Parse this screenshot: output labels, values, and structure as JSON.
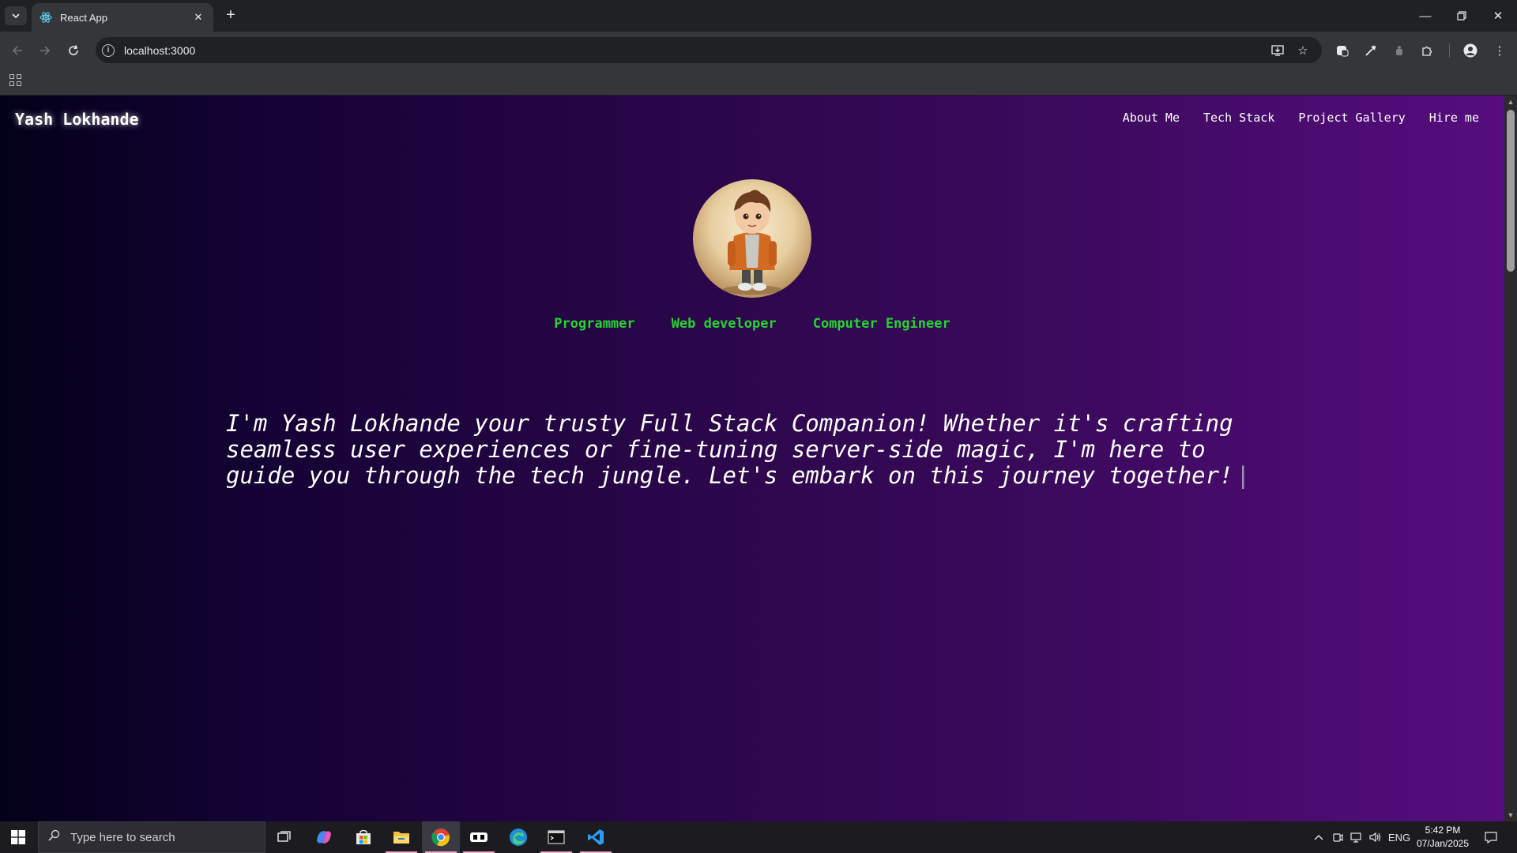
{
  "browser": {
    "tab_title": "React App",
    "url": "localhost:3000"
  },
  "site": {
    "brand": "Yash Lokhande",
    "nav": [
      "About Me",
      "Tech Stack",
      "Project Gallery",
      "Hire me"
    ],
    "roles": [
      "Programmer",
      "Web developer",
      "Computer Engineer"
    ],
    "intro": "I'm Yash Lokhande your trusty Full Stack Companion! Whether it's crafting seamless user experiences or fine-tuning server-side magic, I'm here to guide you through the tech jungle. Let's embark on this journey together!",
    "typing_cursor": "|",
    "colors": {
      "role_text": "#22d62e",
      "gradient_start": "#03011a",
      "gradient_end": "#560d7e"
    }
  },
  "taskbar": {
    "search_placeholder": "Type here to search",
    "language": "ENG",
    "time": "5:42 PM",
    "date": "07/Jan/2025"
  }
}
